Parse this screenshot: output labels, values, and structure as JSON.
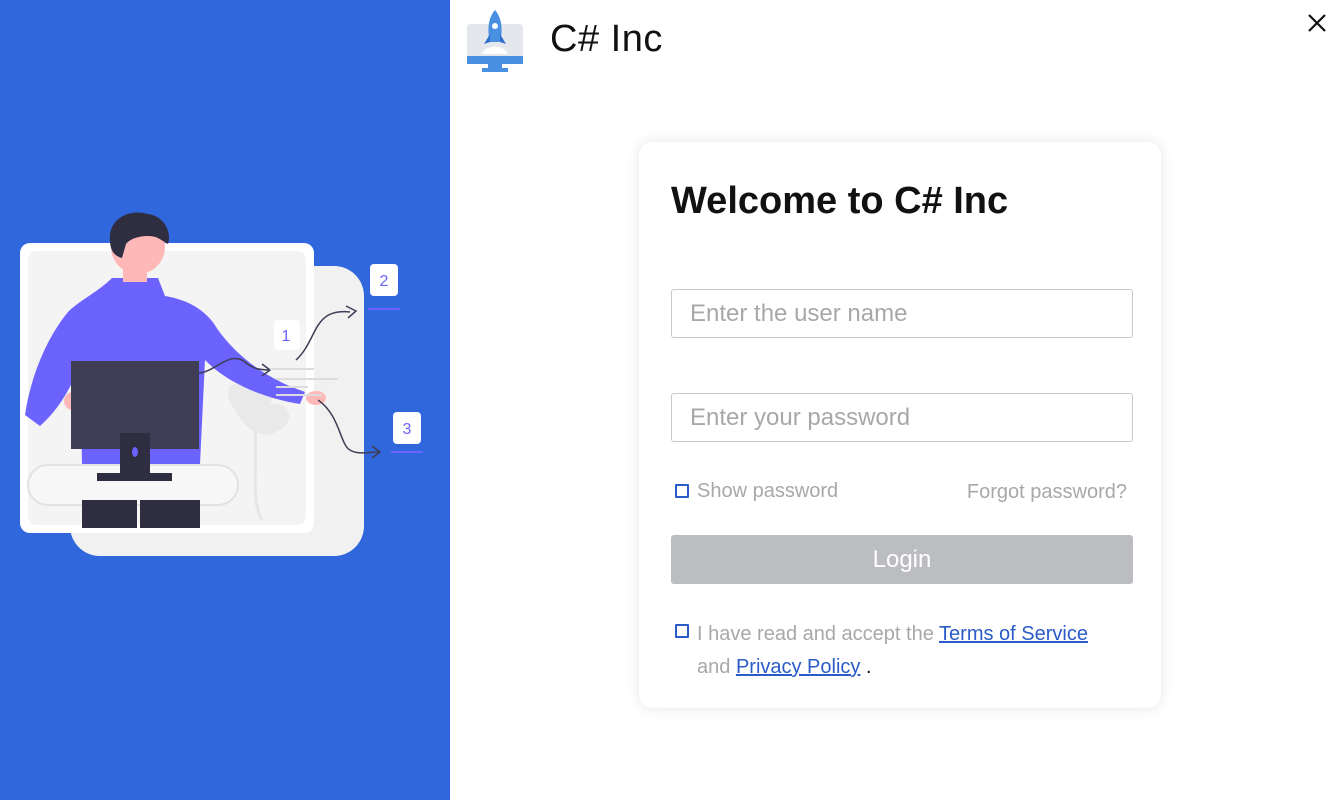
{
  "app": {
    "title": "C# Inc",
    "logo_icon": "rocket-monitor-icon",
    "close_icon": "close-icon"
  },
  "left_panel": {
    "background_color": "#3067dd",
    "illustration": {
      "icon": "person-at-computer-illustration",
      "step_numbers": [
        "1",
        "2",
        "3"
      ]
    }
  },
  "login_card": {
    "title": "Welcome to C# Inc",
    "username": {
      "placeholder": "Enter the user name",
      "value": ""
    },
    "password": {
      "placeholder": "Enter your password",
      "value": ""
    },
    "show_password": {
      "label": "Show password",
      "checked": false
    },
    "forgot_password_label": "Forgot password?",
    "login_button": {
      "label": "Login",
      "color": "#bbbdc0"
    },
    "terms": {
      "checked": false,
      "prefix": "I have read and accept the ",
      "terms_link": "Terms of Service",
      "conjunction": "and",
      "privacy_link": "Privacy Policy",
      "suffix": "."
    }
  },
  "colors": {
    "accent": "#2a5bc9",
    "muted_text": "#a8a8a8"
  }
}
